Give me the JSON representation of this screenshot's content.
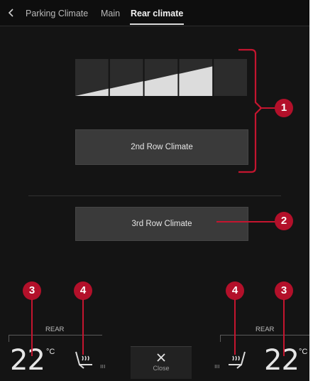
{
  "tabs": {
    "items": [
      {
        "label": "Parking Climate",
        "active": false
      },
      {
        "label": "Main",
        "active": false
      },
      {
        "label": "Rear climate",
        "active": true
      }
    ]
  },
  "fan_level": {
    "value": 4,
    "max": 5
  },
  "buttons": {
    "second_row": "2nd Row Climate",
    "third_row": "3rd Row Climate"
  },
  "bottom": {
    "left_section_label": "REAR",
    "right_section_label": "REAR",
    "left_temp": "22",
    "right_temp": "22",
    "temp_unit": "°C",
    "close_label": "Close",
    "seat_heat_level_marks": "ııı"
  },
  "callouts": [
    "1",
    "2",
    "3",
    "4",
    "4",
    "3"
  ],
  "colors": {
    "background": "#141414",
    "callout": "#b3102a",
    "button": "#3a3a3a"
  },
  "icons": [
    "chevron-left-icon",
    "close-icon",
    "heated-seat-icon"
  ]
}
